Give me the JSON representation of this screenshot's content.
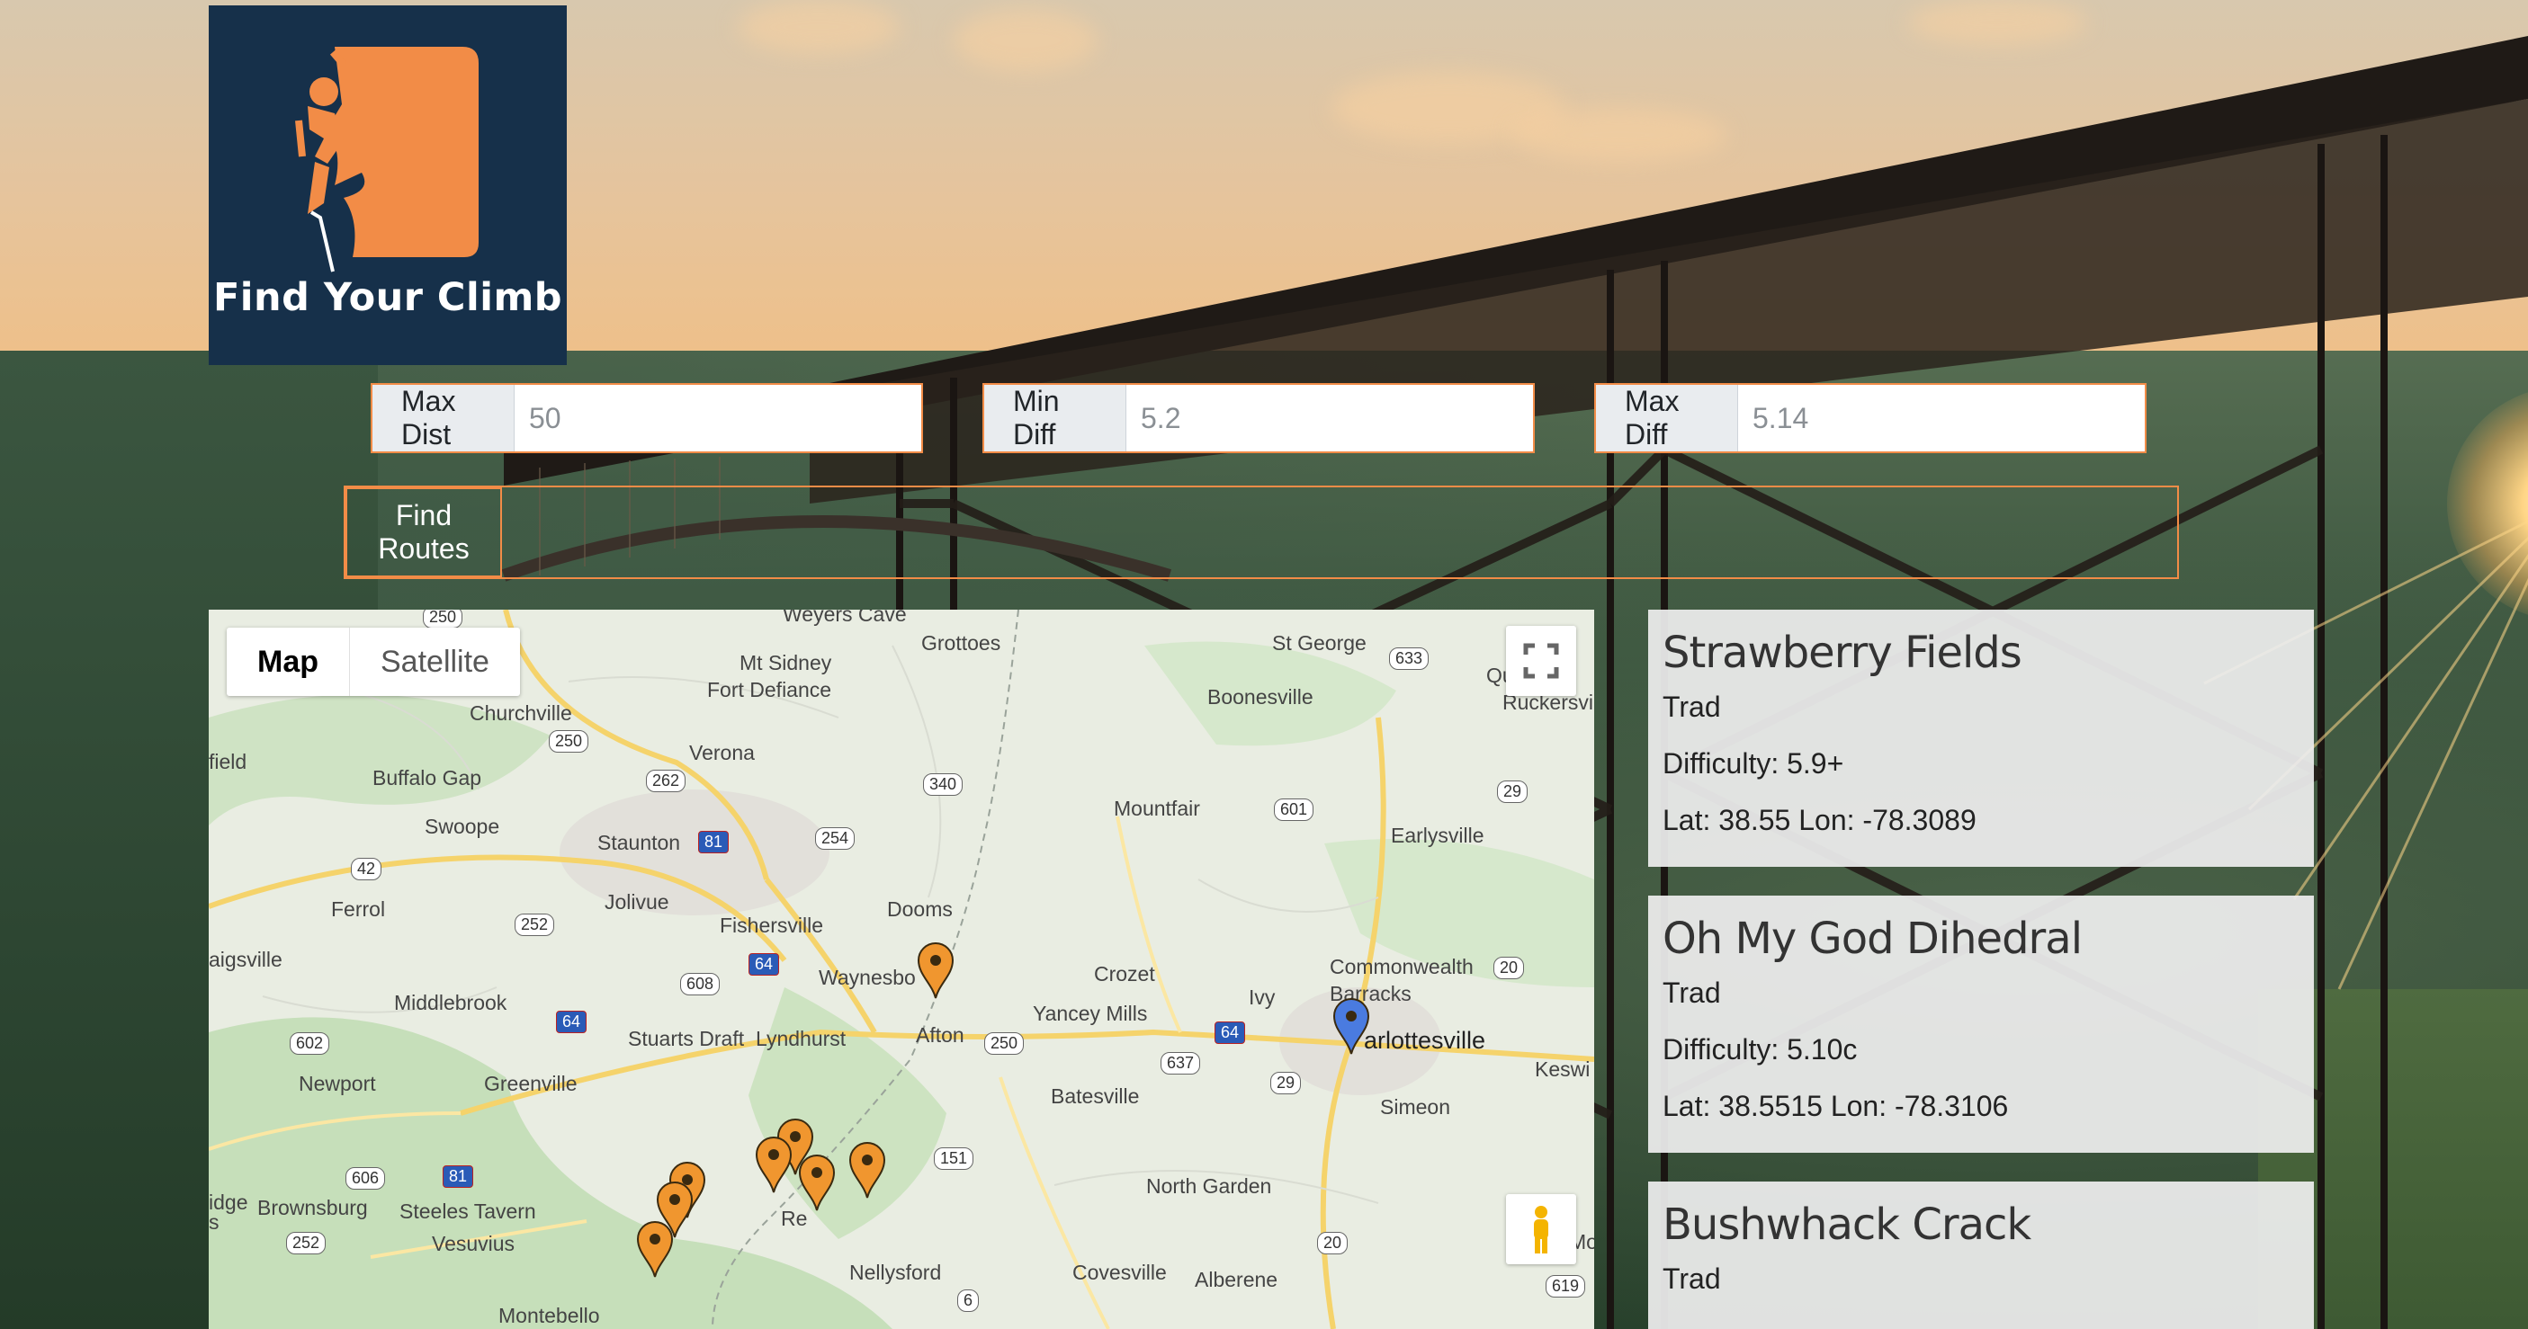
{
  "brand": {
    "name": "Find Your Climb"
  },
  "filters": [
    {
      "label": "Max Dist",
      "placeholder": "50"
    },
    {
      "label": "Min Diff",
      "placeholder": "5.2"
    },
    {
      "label": "Max Diff",
      "placeholder": "5.14"
    }
  ],
  "find_button_label": "Find Routes",
  "map": {
    "type_controls": {
      "map": "Map",
      "satellite": "Satellite"
    },
    "places": [
      "Weyers Cave",
      "Grottoes",
      "St George",
      "Mt Sidney",
      "Fort Defiance",
      "Boonesville",
      "Ruckersvi",
      "Churchville",
      "Verona",
      "field",
      "Buffalo Gap",
      "Mountfair",
      "Earlysville",
      "Swoope",
      "Staunton",
      "Ferrol",
      "Jolivue",
      "Fishersville",
      "Dooms",
      "aigsville",
      "Waynesbo",
      "Crozet",
      "Commonwealth",
      "Barracks",
      "Middlebrook",
      "Yancey Mills",
      "Ivy",
      "arlottesville",
      "Keswi",
      "Stuarts Draft",
      "Lyndhurst",
      "Afton",
      "Newport",
      "Greenville",
      "Batesville",
      "Simeon",
      "North Garden",
      "idge",
      "s",
      "Brownsburg",
      "Steeles Tavern",
      "Vesuvius",
      "Nellysford",
      "Covesville",
      "Alberene",
      "Mo",
      "Montebello",
      "Qu",
      "Re"
    ],
    "shields": [
      "250",
      "633",
      "250",
      "262",
      "340",
      "29",
      "81",
      "254",
      "601",
      "42",
      "252",
      "64",
      "608",
      "64",
      "20",
      "602",
      "250",
      "637",
      "64",
      "29",
      "606",
      "81",
      "151",
      "252",
      "20",
      "6",
      "619"
    ],
    "marker_color": "#f0962f",
    "current_marker_color": "#4a7be0"
  },
  "routes": [
    {
      "name": "Strawberry Fields",
      "type": "Trad",
      "difficulty": "Difficulty: 5.9+",
      "coords": "Lat: 38.55 Lon: -78.3089"
    },
    {
      "name": "Oh My God Dihedral",
      "type": "Trad",
      "difficulty": "Difficulty: 5.10c",
      "coords": "Lat: 38.5515 Lon: -78.3106"
    },
    {
      "name": "Bushwhack Crack",
      "type": "Trad"
    }
  ],
  "colors": {
    "accent": "#f28c47",
    "logo_bg": "#16304a",
    "logo_orange": "#f28c47"
  }
}
